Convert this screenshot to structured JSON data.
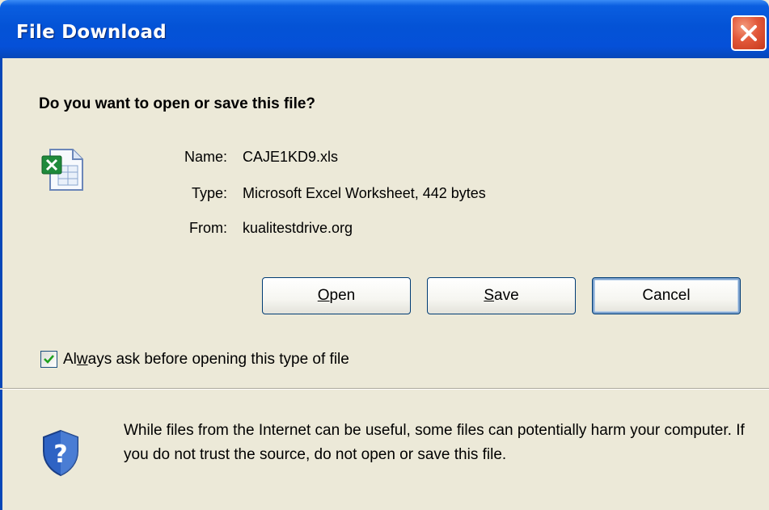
{
  "window": {
    "title": "File Download",
    "close_icon": "close-icon"
  },
  "dialog": {
    "question": "Do you want to open or save this file?",
    "file_icon": "excel-file-icon",
    "name_label": "Name:",
    "name_value": "CAJE1KD9.xls",
    "type_label": "Type:",
    "type_value": "Microsoft Excel Worksheet, 442 bytes",
    "from_label": "From:",
    "from_value": "kualitestdrive.org"
  },
  "buttons": {
    "open_mnemonic": "O",
    "open_rest": "pen",
    "save_mnemonic": "S",
    "save_rest": "ave",
    "cancel_label": "Cancel"
  },
  "always_ask": {
    "checked": true,
    "label_prefix": "Al",
    "label_mnemonic": "w",
    "label_rest": "ays ask before opening this type of file"
  },
  "warning": {
    "icon": "shield-icon",
    "text": "While files from the Internet can be useful, some files can potentially harm your computer. If you do not trust the source, do not open or save this file."
  },
  "colors": {
    "titlebar": "#0453d6",
    "dialog_bg": "#ece9d8",
    "close_button": "#e2583a",
    "button_border": "#003c74"
  }
}
